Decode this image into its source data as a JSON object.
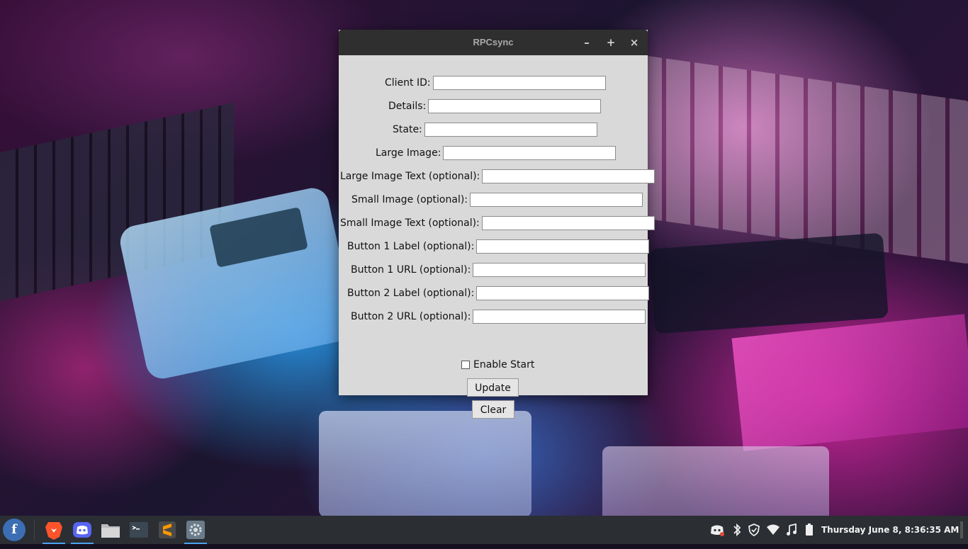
{
  "window": {
    "title": "RPCsync",
    "minimize_glyph": "–",
    "maximize_glyph": "+",
    "close_glyph": "×"
  },
  "form": {
    "fields": [
      {
        "label": "Client ID:",
        "value": ""
      },
      {
        "label": "Details:",
        "value": ""
      },
      {
        "label": "State:",
        "value": ""
      },
      {
        "label": "Large Image:",
        "value": ""
      },
      {
        "label": "Large Image Text (optional):",
        "value": ""
      },
      {
        "label": "Small Image (optional):",
        "value": ""
      },
      {
        "label": "Small Image Text (optional):",
        "value": ""
      },
      {
        "label": "Button 1 Label (optional):",
        "value": ""
      },
      {
        "label": "Button 1 URL (optional):",
        "value": ""
      },
      {
        "label": "Button 2 Label (optional):",
        "value": ""
      },
      {
        "label": "Button 2 URL (optional):",
        "value": ""
      }
    ],
    "enable_start": {
      "label": "Enable Start",
      "checked": false
    },
    "update_label": "Update",
    "clear_label": "Clear"
  },
  "taskbar": {
    "launcher_glyph": "f",
    "apps": [
      {
        "name": "brave-browser-icon",
        "color": "#fb542b"
      },
      {
        "name": "discord-icon",
        "color": "#5865f2"
      },
      {
        "name": "files-icon",
        "color": "#c9c9c9"
      },
      {
        "name": "terminal-icon",
        "color": "#3b4752"
      },
      {
        "name": "sublime-text-icon",
        "color": "#ff9800"
      },
      {
        "name": "settings-icon",
        "color": "#6a7c8a"
      }
    ],
    "tray_icons": [
      "discord-tray-icon",
      "bluetooth-icon",
      "shield-icon",
      "wifi-icon",
      "music-icon",
      "battery-icon"
    ],
    "clock": "Thursday June  8, 8:36:35 AM"
  }
}
